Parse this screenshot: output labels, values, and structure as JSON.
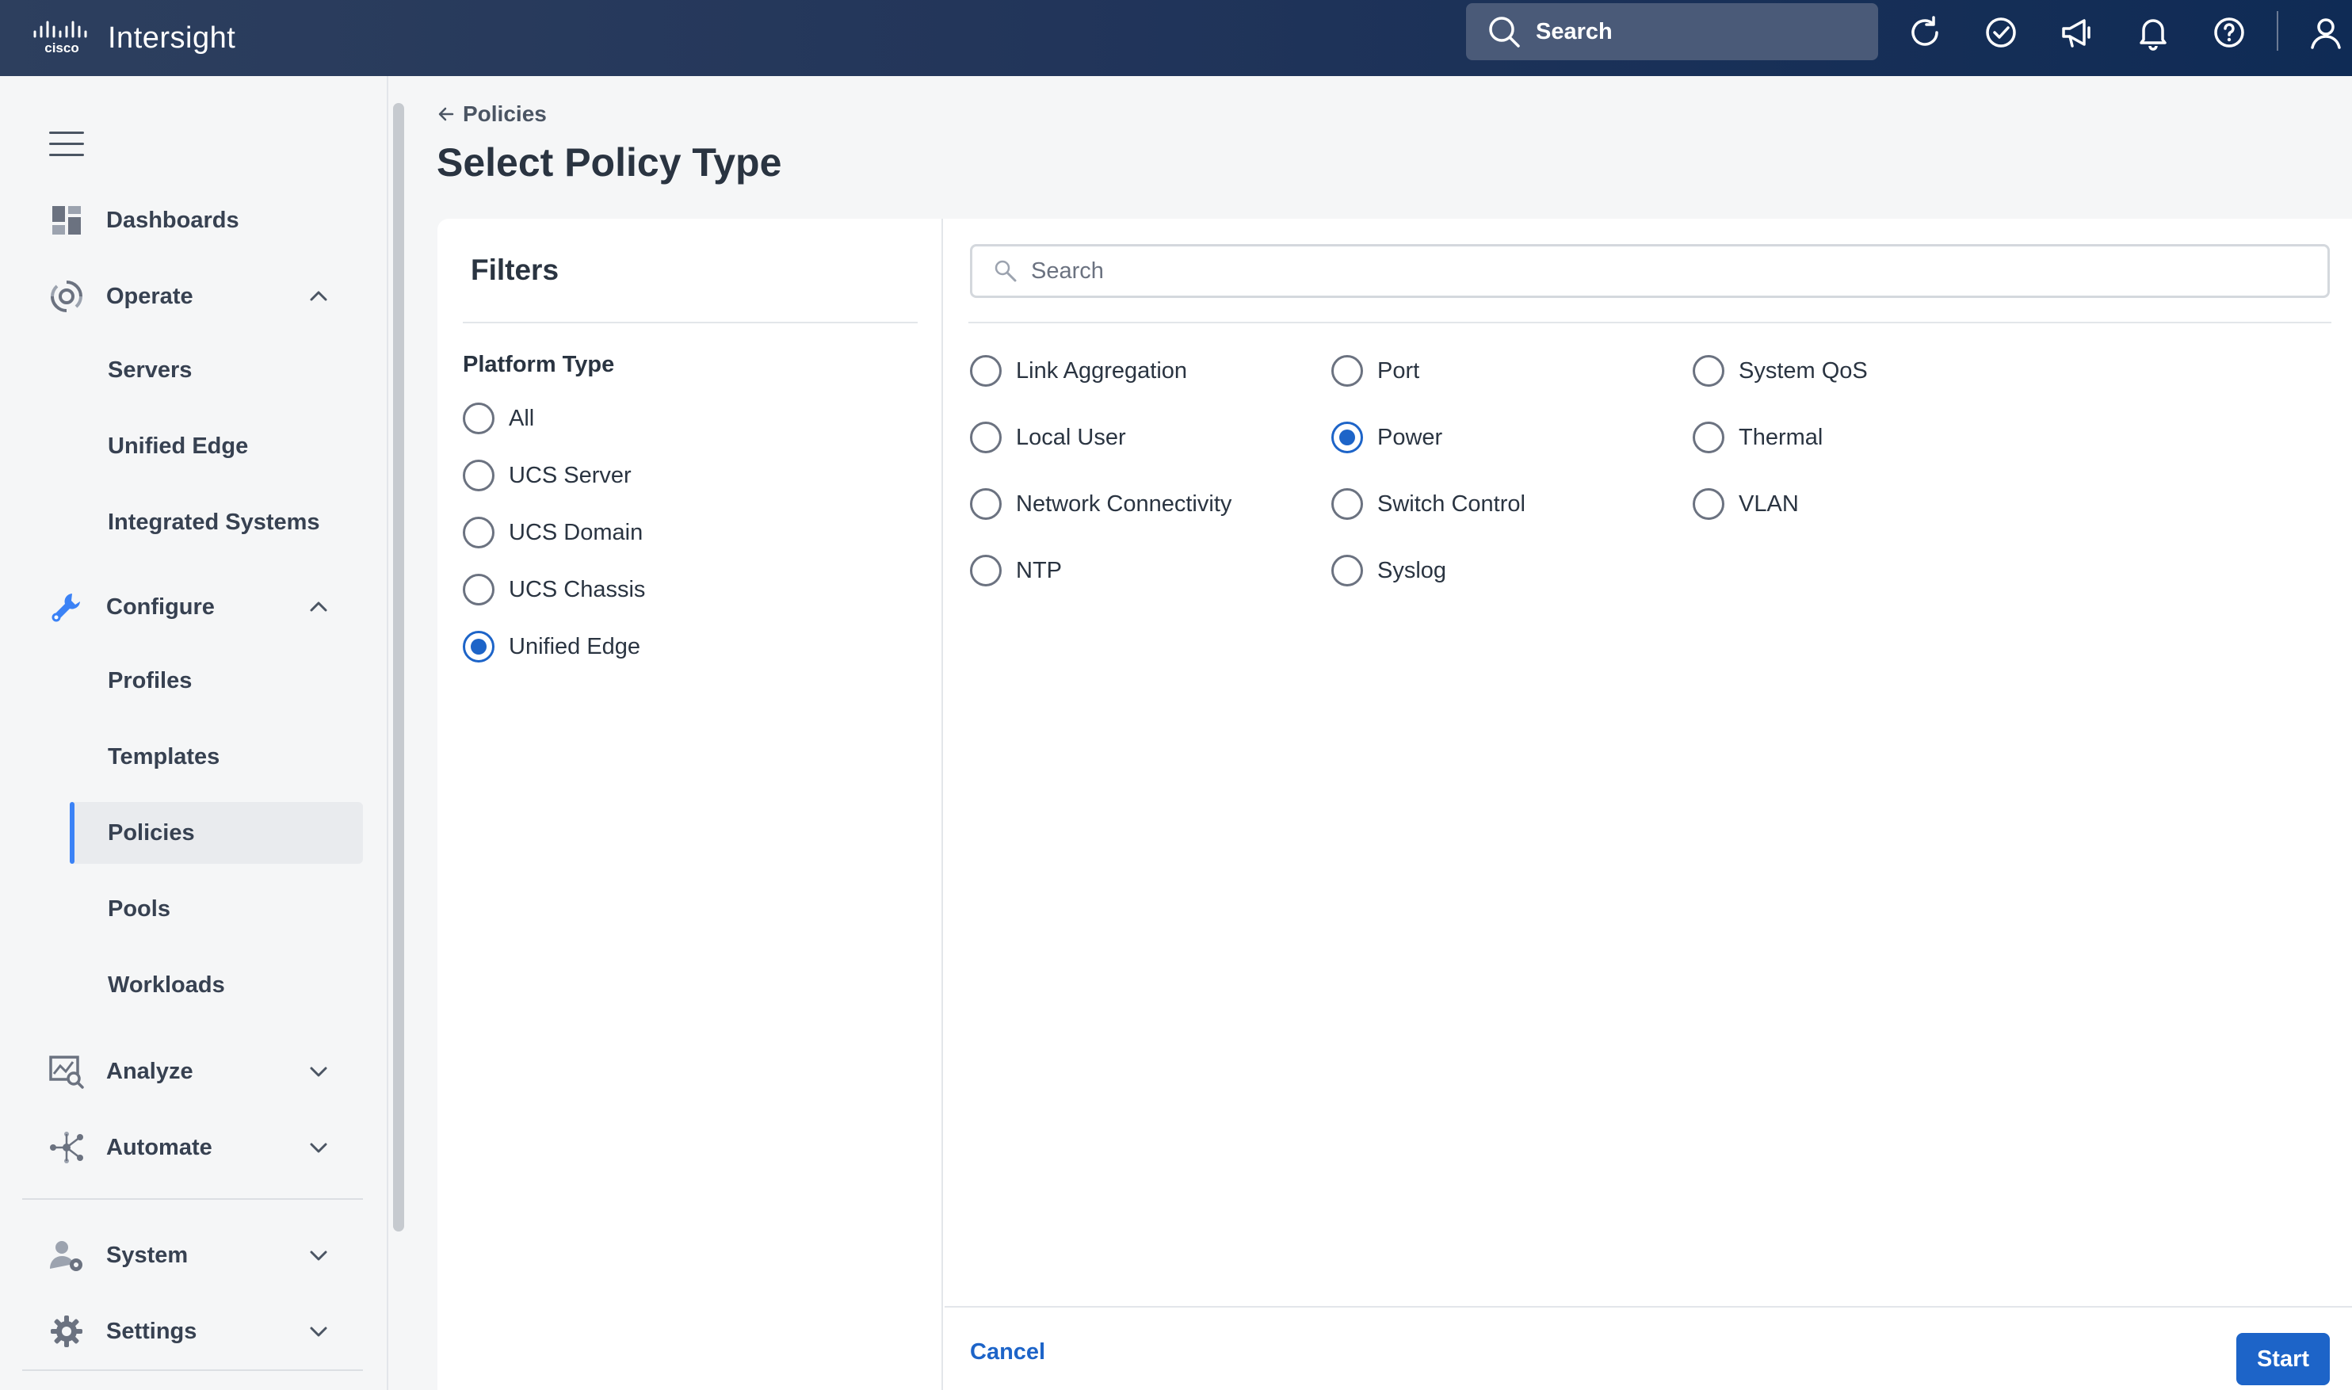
{
  "topbar": {
    "brand_logo_text": "cisco",
    "app_name": "Intersight",
    "search_placeholder": "Search",
    "icons": [
      "refresh-icon",
      "check-circle-icon",
      "megaphone-icon",
      "bell-icon",
      "help-icon",
      "user-icon"
    ]
  },
  "sidebar": {
    "dashboards": "Dashboards",
    "operate": {
      "label": "Operate",
      "items": [
        "Servers",
        "Unified Edge",
        "Integrated Systems"
      ]
    },
    "configure": {
      "label": "Configure",
      "items": [
        "Profiles",
        "Templates",
        "Policies",
        "Pools",
        "Workloads"
      ],
      "active": "Policies"
    },
    "analyze": "Analyze",
    "automate": "Automate",
    "system": "System",
    "settings": "Settings"
  },
  "page": {
    "back_link": "Policies",
    "title": "Select Policy Type"
  },
  "filters": {
    "title": "Filters",
    "platform_type_label": "Platform Type",
    "options": [
      "All",
      "UCS Server",
      "UCS Domain",
      "UCS Chassis",
      "Unified Edge"
    ],
    "selected": "Unified Edge"
  },
  "policies": {
    "search_placeholder": "Search",
    "items": [
      "Link Aggregation",
      "Local User",
      "Network Connectivity",
      "NTP",
      "Port",
      "Power",
      "Switch Control",
      "Syslog",
      "System QoS",
      "Thermal",
      "VLAN"
    ],
    "selected": "Power"
  },
  "actions": {
    "cancel": "Cancel",
    "start": "Start"
  },
  "colors": {
    "topbar": "#22355a",
    "accent": "#1d64c8",
    "active_indicator": "#3b82f6"
  }
}
